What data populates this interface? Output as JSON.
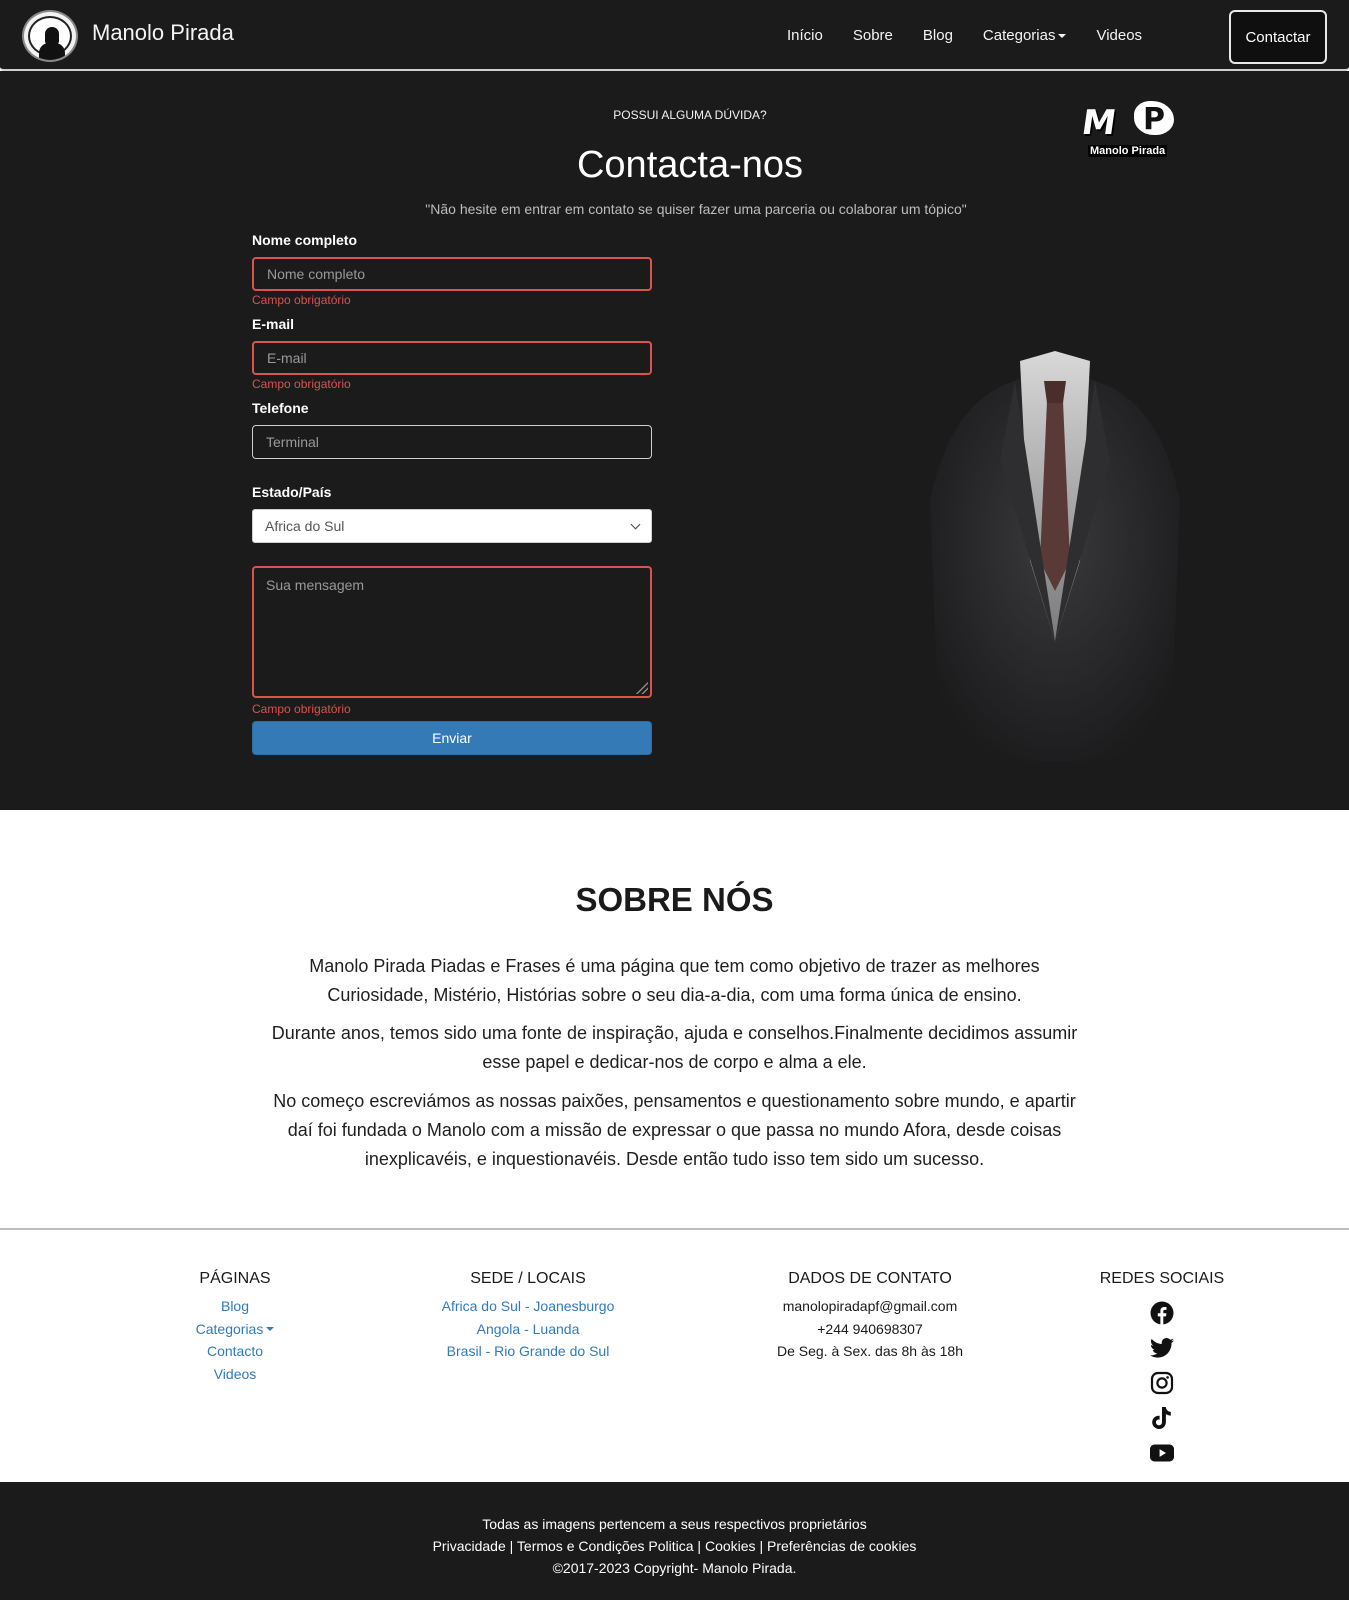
{
  "navbar": {
    "brand": "Manolo Pirada",
    "links": [
      "Início",
      "Sobre",
      "Blog",
      "Categorias",
      "Videos"
    ],
    "contact_button": "Contactar"
  },
  "contact": {
    "eyebrow": "POSSUI ALGUMA DÚVIDA?",
    "title": "Contacta-nos",
    "subtitle": "\"Não hesite em entrar em contato se quiser fazer uma parceria ou colaborar um tópico\"",
    "logo_text": "Manolo Pirada",
    "fields": {
      "name": {
        "label": "Nome completo",
        "placeholder": "Nome completo",
        "error": "Campo obrigatório"
      },
      "email": {
        "label": "E-mail",
        "placeholder": "E-mail",
        "error": "Campo obrigatório"
      },
      "phone": {
        "label": "Telefone",
        "placeholder": "Terminal"
      },
      "country": {
        "label": "Estado/País",
        "selected": "Africa do Sul"
      },
      "message": {
        "placeholder": "Sua mensagem",
        "error": "Campo obrigatório"
      }
    },
    "submit": "Enviar"
  },
  "about": {
    "title": "SOBRE NÓS",
    "paragraphs": [
      "Manolo Pirada Piadas e Frases é uma página que tem como objetivo de trazer as melhores Curiosidade, Mistério, Histórias sobre o seu dia-a-dia, com uma forma única de ensino.",
      "Durante anos, temos sido uma fonte de inspiração, ajuda e conselhos.Finalmente decidimos assumir esse papel e dedicar-nos de corpo e alma a ele.",
      "No começo escreviámos as nossas paixões, pensamentos e questionamento sobre mundo, e apartir daí foi fundada o Manolo com a missão de expressar o que passa no mundo Afora, desde coisas inexplicavéis, e inquestionavéis. Desde então tudo isso tem sido um sucesso."
    ]
  },
  "footer": {
    "pages": {
      "heading": "PÁGINAS",
      "links": [
        "Blog",
        "Categorias",
        "Contacto",
        "Videos"
      ]
    },
    "locations": {
      "heading": "SEDE / LOCAIS",
      "links": [
        "Africa do Sul - Joanesburgo",
        "Angola - Luanda",
        "Brasil - Rio Grande do Sul"
      ]
    },
    "contact": {
      "heading": "DADOS DE CONTATO",
      "email": "manolopiradapf@gmail.com",
      "phone": "+244 940698307",
      "hours": "De Seg. à Sex. das 8h às 18h"
    },
    "social": {
      "heading": "REDES SOCIAIS",
      "icons": [
        "facebook-icon",
        "twitter-icon",
        "instagram-icon",
        "tiktok-icon",
        "youtube-icon"
      ]
    }
  },
  "bottom": {
    "rights": "Todas as imagens pertencem a seus respectivos proprietários",
    "links": [
      "Privacidade",
      "Termos e Condições Politica",
      "Cookies",
      "Preferências de cookies"
    ],
    "separator": " | ",
    "copyright": "©2017-2023 Copyright- Manolo Pirada."
  },
  "colors": {
    "dark_background": "#1b1b1c",
    "accent_blue": "#337ab7",
    "error_red": "#d9534f"
  }
}
